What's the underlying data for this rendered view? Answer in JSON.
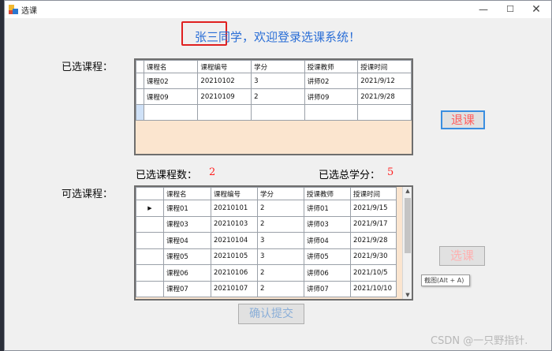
{
  "window": {
    "title": "选课",
    "min_glyph": "—",
    "max_glyph": "☐",
    "close_glyph": "✕",
    "icon": "app-icon"
  },
  "welcome": "张三同学，欢迎登录选课系统！",
  "selected": {
    "label": "已选课程：",
    "columns": [
      "课程名",
      "课程编号",
      "学分",
      "授课教师",
      "授课时间"
    ],
    "rows": [
      [
        "课程02",
        "20210102",
        "3",
        "讲师02",
        "2021/9/12"
      ],
      [
        "课程09",
        "20210109",
        "2",
        "讲师09",
        "2021/9/28"
      ]
    ],
    "count_label": "已选课程数：",
    "count_value": "2",
    "credits_label": "已选总学分：",
    "credits_value": "5"
  },
  "available": {
    "label": "可选课程：",
    "columns": [
      "课程名",
      "课程编号",
      "学分",
      "授课教师",
      "授课时间"
    ],
    "rows": [
      [
        "课程01",
        "20210101",
        "2",
        "讲师01",
        "2021/9/15"
      ],
      [
        "课程03",
        "20210103",
        "2",
        "讲师03",
        "2021/9/17"
      ],
      [
        "课程04",
        "20210104",
        "3",
        "讲师04",
        "2021/9/28"
      ],
      [
        "课程05",
        "20210105",
        "3",
        "讲师05",
        "2021/9/30"
      ],
      [
        "课程06",
        "20210106",
        "2",
        "讲师06",
        "2021/10/5"
      ],
      [
        "课程07",
        "20210107",
        "2",
        "讲师07",
        "2021/10/10"
      ]
    ]
  },
  "buttons": {
    "drop": "退课",
    "select": "选课",
    "submit": "确认提交"
  },
  "tooltip": "截图(Alt + A)",
  "watermark": "CSDN @一只野指针.",
  "colors": {
    "accent_blue": "#2a6ed6",
    "highlight_red": "#e02020",
    "count_red": "#ff2020",
    "grid_bg": "#fbe5cf"
  }
}
